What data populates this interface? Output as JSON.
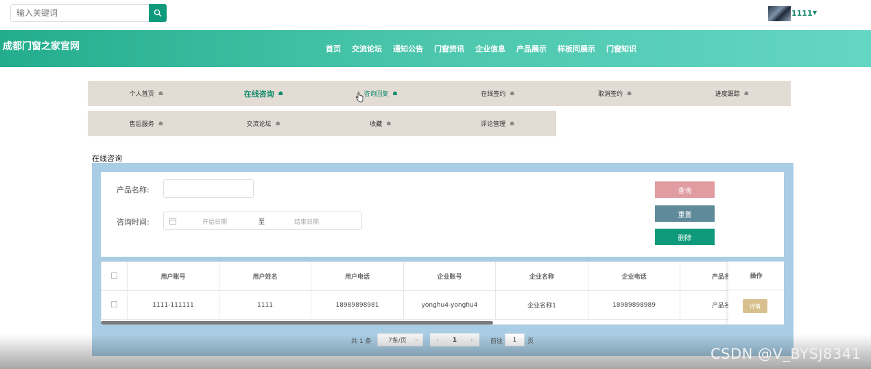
{
  "search": {
    "placeholder": "输入关键词"
  },
  "user": {
    "name": "1111"
  },
  "site": {
    "title": "成都门窗之家官网"
  },
  "nav": [
    "首页",
    "交流论坛",
    "通知公告",
    "门窗资讯",
    "企业信息",
    "产品展示",
    "样板间展示",
    "门窗知识"
  ],
  "menu": {
    "row1": [
      "个人首页",
      "在线咨询",
      "咨询回复",
      "在线签约",
      "取消签约",
      "进度跟踪"
    ],
    "row2": [
      "售后服务",
      "交流论坛",
      "收藏",
      "评论管理"
    ],
    "active": "在线咨询"
  },
  "section_title": "在线咨询",
  "form": {
    "product_name_label": "产品名称:",
    "consult_time_label": "咨询时间:",
    "start_placeholder": "开始日期",
    "range_separator": "至",
    "end_placeholder": "结束日期",
    "query_btn": "查询",
    "reset_btn": "重置",
    "delete_btn": "删除"
  },
  "table": {
    "headers": [
      "用户账号",
      "用户姓名",
      "用户电话",
      "企业账号",
      "企业名称",
      "企业电话",
      "产品名"
    ],
    "op_header": "操作",
    "rows": [
      [
        "1111-111111",
        "1111",
        "18989898981",
        "yonghu4-yonghu4",
        "企业名称1",
        "18989898989",
        "产品名"
      ]
    ],
    "detail_btn": "详情"
  },
  "pagination": {
    "total": "共 1 条",
    "page_size": "7条/页",
    "current": "1",
    "goto_label": "前往",
    "goto_value": "1",
    "page_suffix": "页"
  },
  "watermark": "CSDN @V_BYSJ8341",
  "colors": {
    "accent": "#0f9b7b",
    "header_start": "#23ad8d",
    "header_end": "#64d6c4",
    "menu_bg": "#e2dcd5",
    "panel_bg": "#a9cde4"
  }
}
